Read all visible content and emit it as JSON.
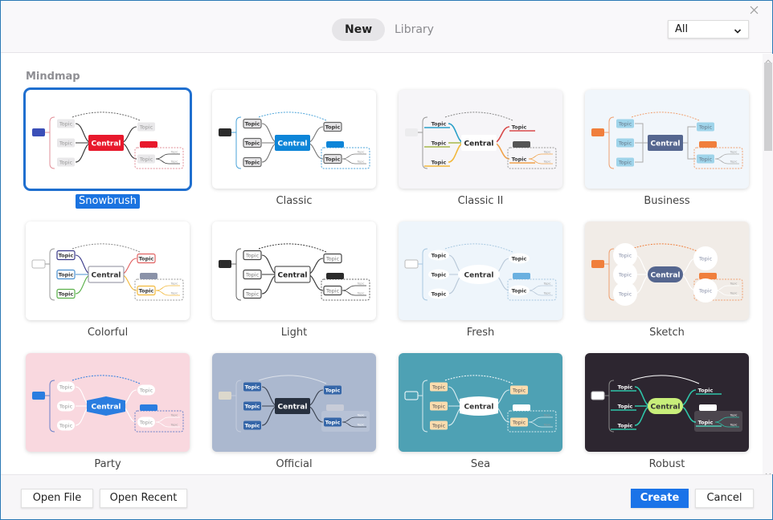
{
  "header": {
    "tabs": [
      {
        "label": "New",
        "active": true
      },
      {
        "label": "Library",
        "active": false
      }
    ],
    "filter": {
      "selected": "All"
    }
  },
  "section": {
    "title": "Mindmap"
  },
  "templates": [
    {
      "name": "Snowbrush",
      "selected": true,
      "theme": {
        "bg": "#ffffff",
        "central_text": "Central",
        "central_fill": "#e8192c",
        "central_text_color": "#ffffff",
        "central_shape": "rect",
        "topic_text": "Topic",
        "topic_fill": "#e9e8ea",
        "topic_stroke": "none",
        "topic_text_color": "#999999",
        "topic_shape": "rect",
        "line": "#333333",
        "floating": "#3b4fb8",
        "summary_tag": "#e8192c",
        "boundary": "#e28f98",
        "relation": "#666666",
        "subtopic_text": "Topic"
      }
    },
    {
      "name": "Classic",
      "selected": false,
      "theme": {
        "bg": "#ffffff",
        "central_text": "Central",
        "central_fill": "#0d85d8",
        "central_text_color": "#ffffff",
        "central_shape": "rect",
        "topic_text": "Topic",
        "topic_fill": "#e7e6e8",
        "topic_stroke": "#666666",
        "topic_text_color": "#333333",
        "topic_shape": "rect",
        "line": "#777777",
        "floating": "#2b2b2b",
        "summary_tag": "#0d85d8",
        "boundary": "#4aa3d9",
        "relation": "#4aa3d9",
        "subtopic_text": "Topic"
      }
    },
    {
      "name": "Classic II",
      "selected": false,
      "theme": {
        "bg": "#f6f5f8",
        "central_text": "Central",
        "central_fill": "#ffffff",
        "central_text_color": "#222222",
        "central_shape": "rect",
        "topic_text": "Topic",
        "topic_fill": "none",
        "topic_stroke": "none",
        "topic_text_color": "#333333",
        "topic_shape": "underline",
        "line": "#f0a24a",
        "branch_colors": [
          "#2aa0c8",
          "#a6b84a",
          "#f2b83a",
          "#d84a4a",
          "#f0a24a"
        ],
        "floating": "#ececee",
        "summary_tag": "#555555",
        "boundary": "#999999",
        "relation": "#888888",
        "subtopic_text": "Topic"
      }
    },
    {
      "name": "Business",
      "selected": false,
      "theme": {
        "bg": "#f1f6fb",
        "central_text": "Central",
        "central_fill": "#55668f",
        "central_text_color": "#ffffff",
        "central_shape": "rect",
        "topic_text": "Topic",
        "topic_fill": "#9fd4ea",
        "topic_stroke": "none",
        "topic_text_color": "#667788",
        "topic_shape": "rect",
        "line": "#aaaaaa",
        "floating": "#f07f3c",
        "summary_tag": "#f07f3c",
        "boundary": "#f0a070",
        "relation": "#f0a070",
        "subtopic_text": "Topic",
        "elbow": true
      }
    },
    {
      "name": "Colorful",
      "selected": false,
      "theme": {
        "bg": "#ffffff",
        "central_text": "Central",
        "central_fill": "#ffffff",
        "central_text_color": "#333333",
        "central_shape": "rect",
        "central_stroke": "#8a8a98",
        "topic_text": "Topic",
        "topic_fill": "#ffffff",
        "topic_stroke": "#5a4ea8",
        "topic_text_color": "#333333",
        "topic_shape": "rect",
        "line": "#f2b83a",
        "branch_colors": [
          "#3a3a8a",
          "#4a90d0",
          "#5ab04a",
          "#e06060",
          "#f2b83a"
        ],
        "floating": "#ffffff",
        "summary_tag": "#8a92a8",
        "boundary": "#999999",
        "relation": "#888888",
        "subtopic_text": "Topic"
      }
    },
    {
      "name": "Light",
      "selected": false,
      "theme": {
        "bg": "#ffffff",
        "central_text": "Central",
        "central_fill": "#ffffff",
        "central_text_color": "#222222",
        "central_shape": "rect",
        "central_stroke": "#333333",
        "topic_text": "Topic",
        "topic_fill": "#ffffff",
        "topic_stroke": "#444444",
        "topic_text_color": "#777777",
        "topic_shape": "rect",
        "line": "#333333",
        "floating": "#2b2b2b",
        "summary_tag": "#2b2b2b",
        "boundary": "#666666",
        "relation": "#333333",
        "subtopic_text": "Topic"
      }
    },
    {
      "name": "Fresh",
      "selected": false,
      "theme": {
        "bg": "#eef5fb",
        "central_text": "Central",
        "central_fill": "#ffffff",
        "central_text_color": "#333333",
        "central_shape": "ellipse",
        "topic_text": "Topic",
        "topic_fill": "#ffffff",
        "topic_stroke": "none",
        "topic_text_color": "#333333",
        "topic_shape": "ellipse",
        "line": "#b8c8d8",
        "floating": "#ffffff",
        "summary_tag": "#6ab0e0",
        "boundary": "#a8c8e0",
        "relation": "#a8c8e0",
        "subtopic_text": "Topic"
      }
    },
    {
      "name": "Sketch",
      "selected": false,
      "theme": {
        "bg": "#f1ece7",
        "central_text": "Central",
        "central_fill": "#55668f",
        "central_text_color": "#ffffff",
        "central_shape": "pill",
        "topic_text": "Topic",
        "topic_fill": "#ffffff",
        "topic_stroke": "none",
        "topic_text_color": "#8890a8",
        "topic_shape": "circle",
        "line": "#ffffff",
        "floating": "#f07f3c",
        "summary_tag": "#f07f3c",
        "boundary": "#f0a070",
        "relation": "#f07f3c",
        "subtopic_text": "Topic"
      }
    },
    {
      "name": "Party",
      "selected": false,
      "theme": {
        "bg": "#f9d8df",
        "central_text": "Central",
        "central_fill": "#2a7de0",
        "central_text_color": "#ffffff",
        "central_shape": "hexagon",
        "topic_text": "Topic",
        "topic_fill": "#ffffff",
        "topic_stroke": "none",
        "topic_text_color": "#999999",
        "topic_shape": "rounded",
        "line": "#ffffff",
        "floating": "#2a7de0",
        "summary_tag": "#2a7de0",
        "boundary": "#6a80c8",
        "relation": "#2a7de0",
        "subtopic_text": "Topic"
      }
    },
    {
      "name": "Official",
      "selected": false,
      "theme": {
        "bg": "#abb8cf",
        "central_text": "Central",
        "central_fill": "#27303f",
        "central_text_color": "#ffffff",
        "central_shape": "rect",
        "topic_text": "Topic",
        "topic_fill": "#3566a8",
        "topic_stroke": "none",
        "topic_text_color": "#ffffff",
        "topic_shape": "rect",
        "line": "#3a4250",
        "floating": "#dcd8cc",
        "summary_tag": "#c8ccd8",
        "boundary": "#c4ccdc",
        "relation": "#dde2ea",
        "subtopic_text": "Topic"
      }
    },
    {
      "name": "Sea",
      "selected": false,
      "theme": {
        "bg": "#4ea1b4",
        "central_text": "Central",
        "central_fill": "#ffffff",
        "central_text_color": "#333333",
        "central_shape": "barrel",
        "topic_text": "Topic",
        "topic_fill": "#fbdcae",
        "topic_stroke": "none",
        "topic_text_color": "#555555",
        "topic_shape": "rect",
        "line": "#d8ecf0",
        "floating": "none",
        "summary_tag": "#ffffff",
        "boundary": "#d8ecf0",
        "relation": "#ffffff",
        "subtopic_text": "Topic"
      }
    },
    {
      "name": "Robust",
      "selected": false,
      "theme": {
        "bg": "#2d2630",
        "central_text": "Central",
        "central_fill": "#c8ee7a",
        "central_text_color": "#333333",
        "central_shape": "pill",
        "topic_text": "Topic",
        "topic_fill": "none",
        "topic_stroke": "none",
        "topic_text_color": "#ffffff",
        "topic_shape": "underline",
        "line": "#2ec4a8",
        "floating": "#ffffff",
        "summary_tag": "#ffffff",
        "boundary": "#888888",
        "relation": "#ffffff",
        "subtopic_text": "Topic"
      }
    }
  ],
  "footer": {
    "open_file": "Open File",
    "open_recent": "Open Recent",
    "create": "Create",
    "cancel": "Cancel"
  }
}
